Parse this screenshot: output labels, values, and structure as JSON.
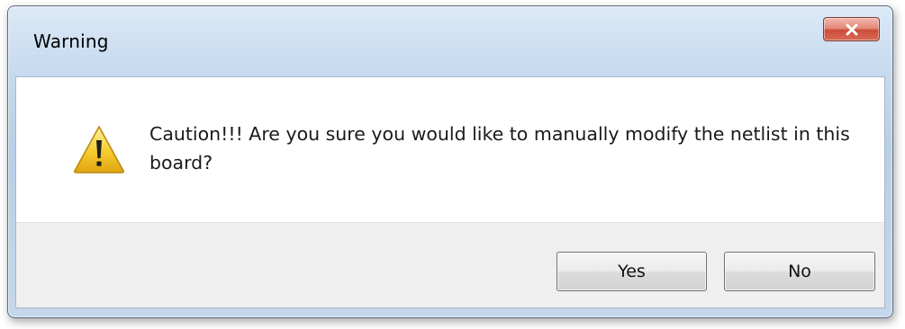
{
  "window": {
    "title": "Warning",
    "close_icon": "close-icon"
  },
  "dialog": {
    "icon": "warning-icon",
    "message": "Caution!!!  Are you sure you would like to manually modify the netlist in this board?"
  },
  "buttons": {
    "yes_label": "Yes",
    "no_label": "No"
  },
  "colors": {
    "titlebar": "#c9dcf0",
    "close_button": "#d76b56",
    "footer": "#efefef",
    "warning_yellow": "#f6cc2c"
  }
}
